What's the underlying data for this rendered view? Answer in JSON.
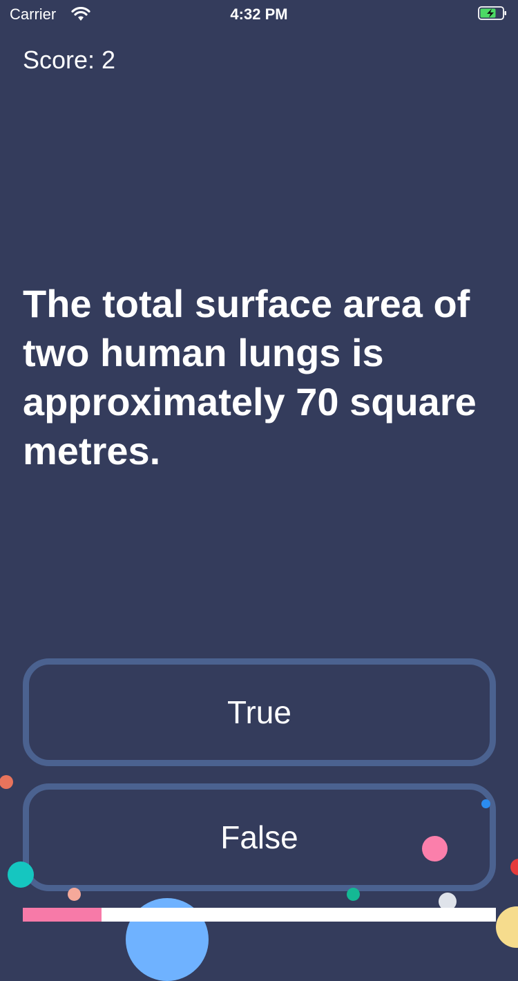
{
  "status_bar": {
    "carrier": "Carrier",
    "time": "4:32 PM",
    "battery_state": "charging"
  },
  "score_label": "Score: 2",
  "question": "The total surface area of two human lungs is approximately 70 square metres.",
  "answers": {
    "true_label": "True",
    "false_label": "False"
  },
  "progress": {
    "fraction": 0.167,
    "color": "#f77aa8"
  },
  "colors": {
    "background": "#343c5c",
    "button_border": "#4b6290",
    "text": "#ffffff"
  }
}
